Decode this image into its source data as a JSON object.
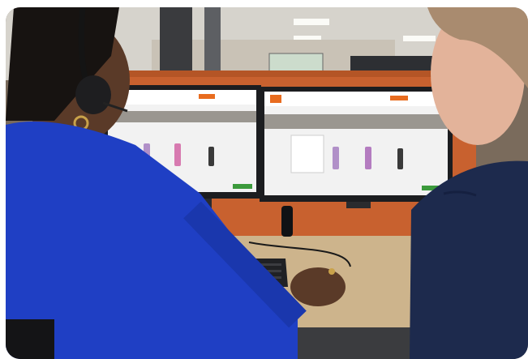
{
  "photo": {
    "colors": {
      "ceiling": "#d9d6cf",
      "back_wall": "#c9c2b6",
      "partition": "#c8612f",
      "desk": "#cdb48c",
      "monitor_bezel": "#1c1d20",
      "screen_bg": "#f2f2f2",
      "screen_banner": "#9a9690",
      "accent_orange": "#e86c1f",
      "accent_green": "#3c9a3c",
      "blazer_blue": "#1f3fc4",
      "navy_shirt": "#1d2a4d",
      "skin_dark": "#5a3a28",
      "skin_light": "#e3b39a",
      "hair_light": "#a98b6f"
    }
  }
}
